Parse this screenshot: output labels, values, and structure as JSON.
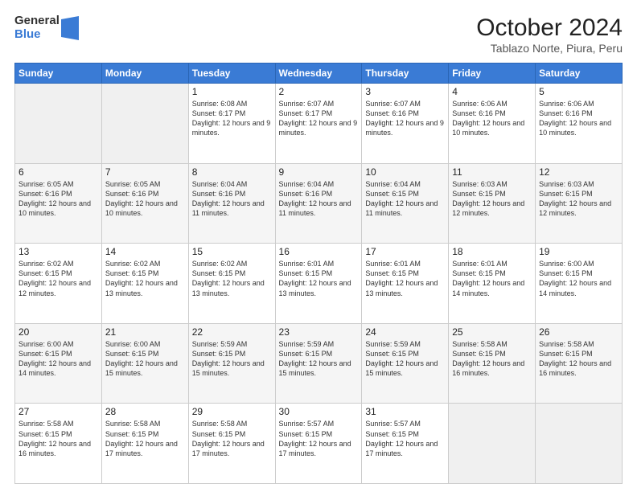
{
  "header": {
    "logo_general": "General",
    "logo_blue": "Blue",
    "title": "October 2024",
    "subtitle": "Tablazo Norte, Piura, Peru"
  },
  "calendar": {
    "days_of_week": [
      "Sunday",
      "Monday",
      "Tuesday",
      "Wednesday",
      "Thursday",
      "Friday",
      "Saturday"
    ],
    "weeks": [
      [
        {
          "day": "",
          "sunrise": "",
          "sunset": "",
          "daylight": "",
          "empty": true
        },
        {
          "day": "",
          "sunrise": "",
          "sunset": "",
          "daylight": "",
          "empty": true
        },
        {
          "day": "1",
          "sunrise": "Sunrise: 6:08 AM",
          "sunset": "Sunset: 6:17 PM",
          "daylight": "Daylight: 12 hours and 9 minutes.",
          "empty": false
        },
        {
          "day": "2",
          "sunrise": "Sunrise: 6:07 AM",
          "sunset": "Sunset: 6:17 PM",
          "daylight": "Daylight: 12 hours and 9 minutes.",
          "empty": false
        },
        {
          "day": "3",
          "sunrise": "Sunrise: 6:07 AM",
          "sunset": "Sunset: 6:16 PM",
          "daylight": "Daylight: 12 hours and 9 minutes.",
          "empty": false
        },
        {
          "day": "4",
          "sunrise": "Sunrise: 6:06 AM",
          "sunset": "Sunset: 6:16 PM",
          "daylight": "Daylight: 12 hours and 10 minutes.",
          "empty": false
        },
        {
          "day": "5",
          "sunrise": "Sunrise: 6:06 AM",
          "sunset": "Sunset: 6:16 PM",
          "daylight": "Daylight: 12 hours and 10 minutes.",
          "empty": false
        }
      ],
      [
        {
          "day": "6",
          "sunrise": "Sunrise: 6:05 AM",
          "sunset": "Sunset: 6:16 PM",
          "daylight": "Daylight: 12 hours and 10 minutes.",
          "empty": false
        },
        {
          "day": "7",
          "sunrise": "Sunrise: 6:05 AM",
          "sunset": "Sunset: 6:16 PM",
          "daylight": "Daylight: 12 hours and 10 minutes.",
          "empty": false
        },
        {
          "day": "8",
          "sunrise": "Sunrise: 6:04 AM",
          "sunset": "Sunset: 6:16 PM",
          "daylight": "Daylight: 12 hours and 11 minutes.",
          "empty": false
        },
        {
          "day": "9",
          "sunrise": "Sunrise: 6:04 AM",
          "sunset": "Sunset: 6:16 PM",
          "daylight": "Daylight: 12 hours and 11 minutes.",
          "empty": false
        },
        {
          "day": "10",
          "sunrise": "Sunrise: 6:04 AM",
          "sunset": "Sunset: 6:15 PM",
          "daylight": "Daylight: 12 hours and 11 minutes.",
          "empty": false
        },
        {
          "day": "11",
          "sunrise": "Sunrise: 6:03 AM",
          "sunset": "Sunset: 6:15 PM",
          "daylight": "Daylight: 12 hours and 12 minutes.",
          "empty": false
        },
        {
          "day": "12",
          "sunrise": "Sunrise: 6:03 AM",
          "sunset": "Sunset: 6:15 PM",
          "daylight": "Daylight: 12 hours and 12 minutes.",
          "empty": false
        }
      ],
      [
        {
          "day": "13",
          "sunrise": "Sunrise: 6:02 AM",
          "sunset": "Sunset: 6:15 PM",
          "daylight": "Daylight: 12 hours and 12 minutes.",
          "empty": false
        },
        {
          "day": "14",
          "sunrise": "Sunrise: 6:02 AM",
          "sunset": "Sunset: 6:15 PM",
          "daylight": "Daylight: 12 hours and 13 minutes.",
          "empty": false
        },
        {
          "day": "15",
          "sunrise": "Sunrise: 6:02 AM",
          "sunset": "Sunset: 6:15 PM",
          "daylight": "Daylight: 12 hours and 13 minutes.",
          "empty": false
        },
        {
          "day": "16",
          "sunrise": "Sunrise: 6:01 AM",
          "sunset": "Sunset: 6:15 PM",
          "daylight": "Daylight: 12 hours and 13 minutes.",
          "empty": false
        },
        {
          "day": "17",
          "sunrise": "Sunrise: 6:01 AM",
          "sunset": "Sunset: 6:15 PM",
          "daylight": "Daylight: 12 hours and 13 minutes.",
          "empty": false
        },
        {
          "day": "18",
          "sunrise": "Sunrise: 6:01 AM",
          "sunset": "Sunset: 6:15 PM",
          "daylight": "Daylight: 12 hours and 14 minutes.",
          "empty": false
        },
        {
          "day": "19",
          "sunrise": "Sunrise: 6:00 AM",
          "sunset": "Sunset: 6:15 PM",
          "daylight": "Daylight: 12 hours and 14 minutes.",
          "empty": false
        }
      ],
      [
        {
          "day": "20",
          "sunrise": "Sunrise: 6:00 AM",
          "sunset": "Sunset: 6:15 PM",
          "daylight": "Daylight: 12 hours and 14 minutes.",
          "empty": false
        },
        {
          "day": "21",
          "sunrise": "Sunrise: 6:00 AM",
          "sunset": "Sunset: 6:15 PM",
          "daylight": "Daylight: 12 hours and 15 minutes.",
          "empty": false
        },
        {
          "day": "22",
          "sunrise": "Sunrise: 5:59 AM",
          "sunset": "Sunset: 6:15 PM",
          "daylight": "Daylight: 12 hours and 15 minutes.",
          "empty": false
        },
        {
          "day": "23",
          "sunrise": "Sunrise: 5:59 AM",
          "sunset": "Sunset: 6:15 PM",
          "daylight": "Daylight: 12 hours and 15 minutes.",
          "empty": false
        },
        {
          "day": "24",
          "sunrise": "Sunrise: 5:59 AM",
          "sunset": "Sunset: 6:15 PM",
          "daylight": "Daylight: 12 hours and 15 minutes.",
          "empty": false
        },
        {
          "day": "25",
          "sunrise": "Sunrise: 5:58 AM",
          "sunset": "Sunset: 6:15 PM",
          "daylight": "Daylight: 12 hours and 16 minutes.",
          "empty": false
        },
        {
          "day": "26",
          "sunrise": "Sunrise: 5:58 AM",
          "sunset": "Sunset: 6:15 PM",
          "daylight": "Daylight: 12 hours and 16 minutes.",
          "empty": false
        }
      ],
      [
        {
          "day": "27",
          "sunrise": "Sunrise: 5:58 AM",
          "sunset": "Sunset: 6:15 PM",
          "daylight": "Daylight: 12 hours and 16 minutes.",
          "empty": false
        },
        {
          "day": "28",
          "sunrise": "Sunrise: 5:58 AM",
          "sunset": "Sunset: 6:15 PM",
          "daylight": "Daylight: 12 hours and 17 minutes.",
          "empty": false
        },
        {
          "day": "29",
          "sunrise": "Sunrise: 5:58 AM",
          "sunset": "Sunset: 6:15 PM",
          "daylight": "Daylight: 12 hours and 17 minutes.",
          "empty": false
        },
        {
          "day": "30",
          "sunrise": "Sunrise: 5:57 AM",
          "sunset": "Sunset: 6:15 PM",
          "daylight": "Daylight: 12 hours and 17 minutes.",
          "empty": false
        },
        {
          "day": "31",
          "sunrise": "Sunrise: 5:57 AM",
          "sunset": "Sunset: 6:15 PM",
          "daylight": "Daylight: 12 hours and 17 minutes.",
          "empty": false
        },
        {
          "day": "",
          "sunrise": "",
          "sunset": "",
          "daylight": "",
          "empty": true
        },
        {
          "day": "",
          "sunrise": "",
          "sunset": "",
          "daylight": "",
          "empty": true
        }
      ]
    ]
  }
}
